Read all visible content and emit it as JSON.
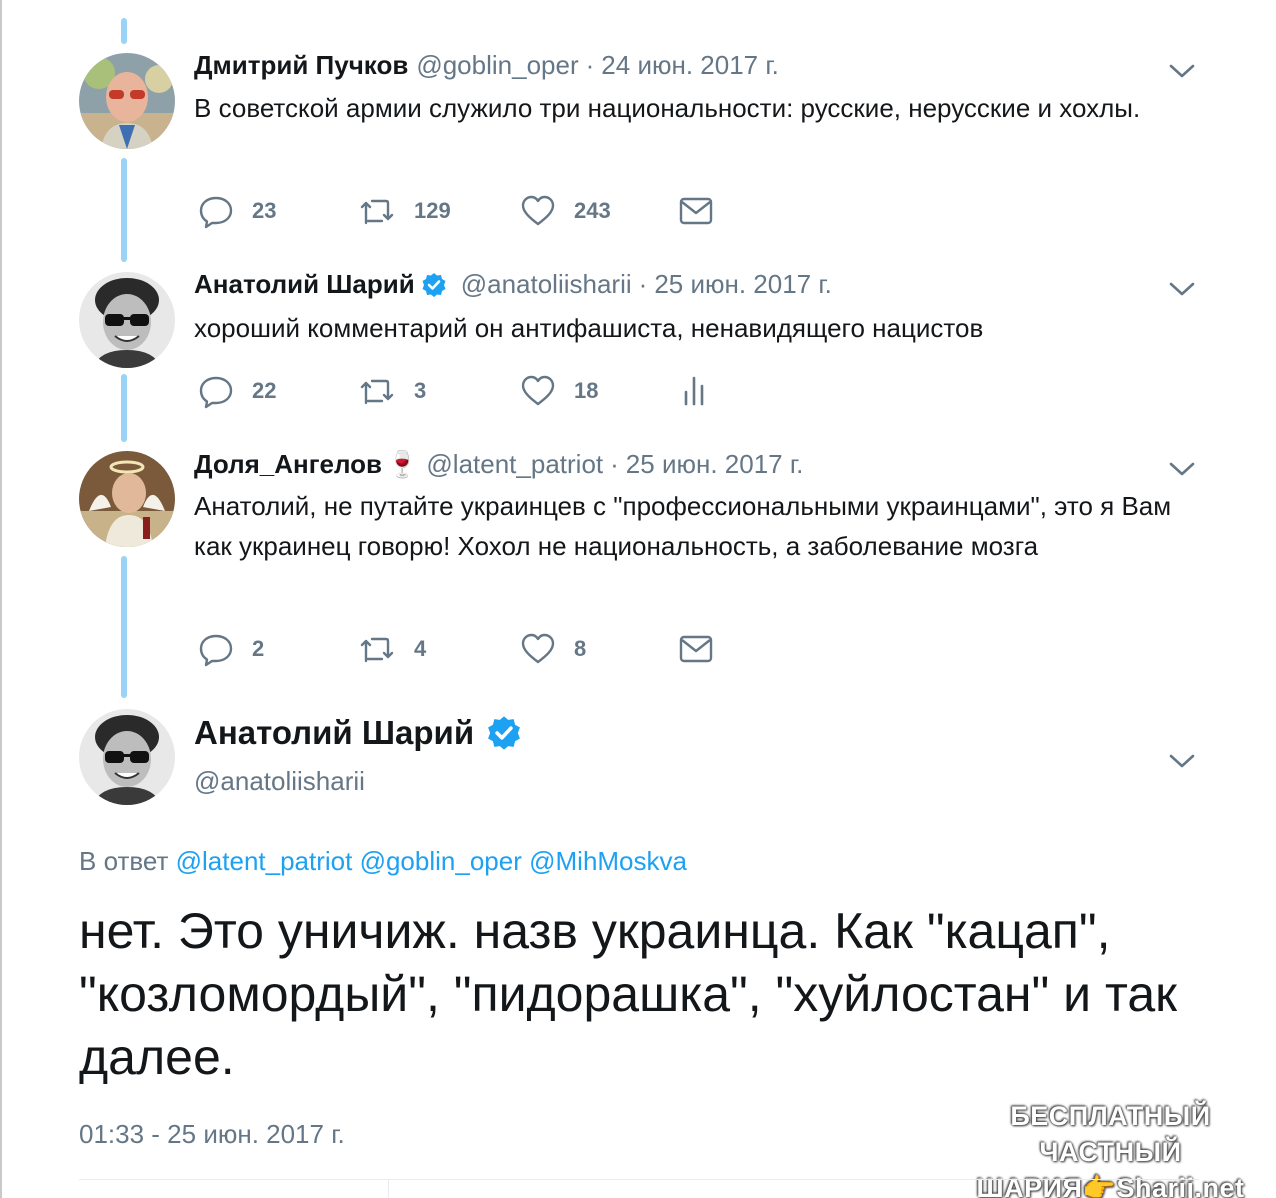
{
  "tweets": [
    {
      "name": "Дмитрий Пучков",
      "handle": "@goblin_oper",
      "date": "24 июн. 2017 г.",
      "text": "В советской армии служило три национальности: русские, нерусские и хохлы.",
      "replies": "23",
      "retweets": "129",
      "likes": "243",
      "last_icon": "envelope-icon"
    },
    {
      "name": "Анатолий Шарий",
      "handle": "@anatoliisharii",
      "date": "25 июн. 2017 г.",
      "text": "хороший комментарий он антифашиста, ненавидящего нацистов",
      "replies": "22",
      "retweets": "3",
      "likes": "18",
      "last_icon": "analytics-icon"
    },
    {
      "name": "Доля_Ангелов",
      "emoji": "🍷",
      "handle": "@latent_patriot",
      "date": "25 июн. 2017 г.",
      "text": "Анатолий, не путайте украинцев с \"профессиональными украинцами\", это я Вам как украинец говорю! Хохол не национальность, а заболевание мозга",
      "replies": "2",
      "retweets": "4",
      "likes": "8",
      "last_icon": "envelope-icon"
    }
  ],
  "main": {
    "name": "Анатолий Шарий",
    "handle": "@anatoliisharii",
    "reply_prefix": "В ответ",
    "reply_links": [
      "@latent_patriot",
      "@goblin_oper",
      "@MihMoskva"
    ],
    "text": "нет. Это уничиж. назв украинца. Как \"кацап\", \"козломордый\", \"пидорашка\", \"хуйлостан\" и так далее.",
    "time": "01:33 - 25 июн. 2017 г."
  },
  "watermark": {
    "line1": "БЕСПЛАТНЫЙ ЧАСТНЫЙ",
    "line2": "ШАРИЯ👉Sharij.net"
  },
  "colors": {
    "thread_line": "#9ad3f5",
    "secondary_text": "#657786",
    "link": "#1da1f2",
    "verified": "#1da1f2"
  }
}
